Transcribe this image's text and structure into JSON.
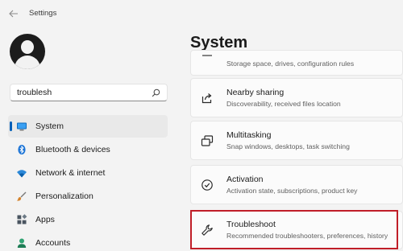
{
  "window": {
    "title": "Settings"
  },
  "search": {
    "value": "troublesh"
  },
  "sidebar": {
    "items": [
      {
        "label": "System",
        "icon": "system-icon",
        "selected": true
      },
      {
        "label": "Bluetooth & devices",
        "icon": "bluetooth-icon"
      },
      {
        "label": "Network & internet",
        "icon": "wifi-icon"
      },
      {
        "label": "Personalization",
        "icon": "brush-icon"
      },
      {
        "label": "Apps",
        "icon": "apps-icon"
      },
      {
        "label": "Accounts",
        "icon": "accounts-icon"
      }
    ]
  },
  "main": {
    "title": "System",
    "cards": [
      {
        "title": "",
        "desc": "Storage space, drives, configuration rules",
        "icon": "storage-icon"
      },
      {
        "title": "Nearby sharing",
        "desc": "Discoverability, received files location",
        "icon": "share-icon"
      },
      {
        "title": "Multitasking",
        "desc": "Snap windows, desktops, task switching",
        "icon": "multitasking-icon"
      },
      {
        "title": "Activation",
        "desc": "Activation state, subscriptions, product key",
        "icon": "check-circle-icon"
      },
      {
        "title": "Troubleshoot",
        "desc": "Recommended troubleshooters, preferences, history",
        "icon": "wrench-icon",
        "highlighted": true
      }
    ]
  },
  "colors": {
    "accent": "#005fb8",
    "highlight": "#c01e28",
    "background": "#f3f3f3",
    "card": "#fbfbfb"
  }
}
